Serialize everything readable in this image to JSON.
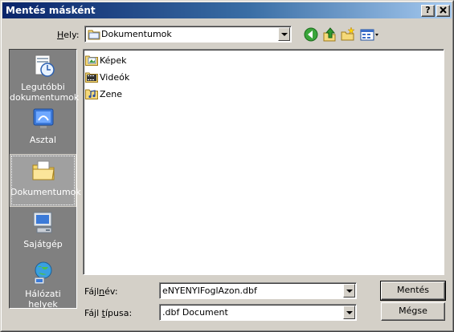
{
  "window": {
    "title": "Mentés másként"
  },
  "titlebar": {
    "help_label": "?",
    "close_label": "X"
  },
  "location": {
    "label_prefix": "",
    "label_hotkey": "H",
    "label_rest": "ely:",
    "current": "Dokumentumok"
  },
  "toolbar": {
    "icons": [
      "back-icon",
      "up-folder-icon",
      "new-folder-icon",
      "view-menu-icon"
    ]
  },
  "places": [
    {
      "label_line1": "Legutóbbi",
      "label_line2": "dokumentumok",
      "icon": "recent-documents-icon"
    },
    {
      "label_line1": "Asztal",
      "label_line2": "",
      "icon": "desktop-icon"
    },
    {
      "label_line1": "Dokumentumok",
      "label_line2": "",
      "icon": "my-documents-icon"
    },
    {
      "label_line1": "Sajátgép",
      "label_line2": "",
      "icon": "my-computer-icon"
    },
    {
      "label_line1": "Hálózati helyek",
      "label_line2": "",
      "icon": "network-places-icon"
    }
  ],
  "files": [
    {
      "name": "Képek",
      "icon": "pictures-folder-icon"
    },
    {
      "name": "Videók",
      "icon": "videos-folder-icon"
    },
    {
      "name": "Zene",
      "icon": "music-folder-icon"
    }
  ],
  "filename": {
    "label_prefix": "Fájl",
    "label_hotkey": "n",
    "label_rest": "év:",
    "value": "eNYENYIFoglAzon.dbf"
  },
  "filetype": {
    "label_prefix": "Fájl ",
    "label_hotkey": "t",
    "label_rest": "ípusa:",
    "value": ".dbf Document"
  },
  "buttons": {
    "save": "Mentés",
    "cancel": "Mégse"
  },
  "colors": {
    "titlebar_start": "#0a246a",
    "titlebar_end": "#a6caf0",
    "face": "#d4d0c8",
    "places_bg": "#808080"
  }
}
